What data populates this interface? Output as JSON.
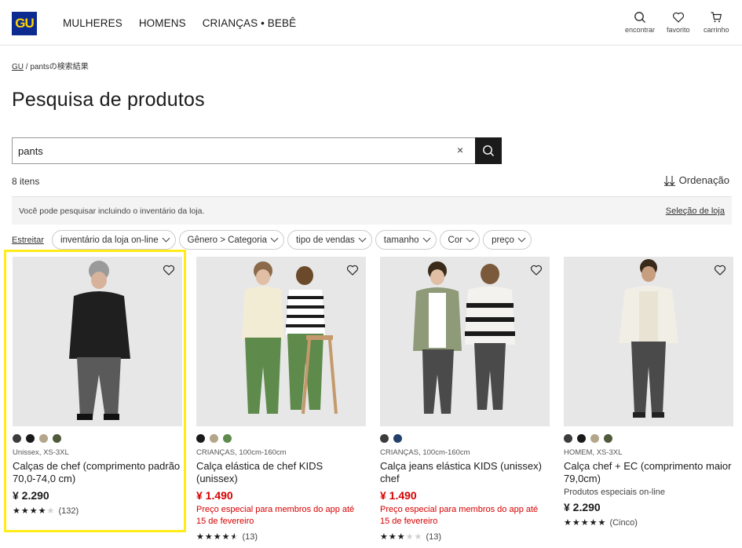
{
  "header": {
    "logo": "GU",
    "nav": [
      "MULHERES",
      "HOMENS",
      "CRIANÇAS • BEBÊ"
    ],
    "utils": {
      "search": "encontrar",
      "favorite": "favorito",
      "cart": "carrinho"
    }
  },
  "breadcrumb": {
    "home": "GU",
    "separator": "/",
    "current": "pantsの検索結果"
  },
  "page_title": "Pesquisa de produtos",
  "search": {
    "value": "pants",
    "clear": "×"
  },
  "results": {
    "count": "8 itens",
    "sort": "Ordenação"
  },
  "notice": {
    "text": "Você pode pesquisar incluindo o inventário da loja.",
    "link": "Seleção de loja"
  },
  "filters": {
    "refine": "Estreitar",
    "chips": [
      "inventário da loja on-line",
      "Gênero > Categoria",
      "tipo de vendas",
      "tamanho",
      "Cor",
      "preço"
    ]
  },
  "colors": {
    "accent_red": "#d70000",
    "highlight": "#ffec1a",
    "logo_bg": "#0c2a8f",
    "logo_fg": "#ffd400"
  },
  "products": [
    {
      "swatches": [
        "#3c3c3c",
        "#1a1a1a",
        "#b3a68a",
        "#4f5a3a"
      ],
      "meta": "Unissex, XS-3XL",
      "name": "Calças de chef (comprimento padrão 70,0-74,0 cm)",
      "price": "¥ 2.290",
      "price_style": "normal",
      "promo": "",
      "special": "",
      "stars": "★★★★★",
      "rating_value": 4,
      "reviews": "(132)"
    },
    {
      "swatches": [
        "#1a1a1a",
        "#b3a68a",
        "#5e8a4c"
      ],
      "meta": "CRIANÇAS, 100cm-160cm",
      "name": "Calça elástica de chef KIDS (unissex)",
      "price": "¥ 1.490",
      "price_style": "red",
      "promo": "Preço especial para membros do app até 15 de fevereiro",
      "special": "",
      "stars": "★★★★★",
      "rating_value": 4.5,
      "reviews": "(13)"
    },
    {
      "swatches": [
        "#3c3c3c",
        "#23406b"
      ],
      "meta": "CRIANÇAS, 100cm-160cm",
      "name": "Calça jeans elástica KIDS (unissex) chef",
      "price": "¥ 1.490",
      "price_style": "red",
      "promo": "Preço especial para membros do app até 15 de fevereiro",
      "special": "",
      "stars": "★★★★★",
      "rating_value": 3,
      "reviews": "(13)"
    },
    {
      "swatches": [
        "#3c3c3c",
        "#1a1a1a",
        "#b3a68a",
        "#4f5a3a"
      ],
      "meta": "HOMEM, XS-3XL",
      "name": "Calça chef + EC (comprimento maior 79,0cm)",
      "price": "¥ 2.290",
      "price_style": "normal",
      "promo": "",
      "special": "Produtos especiais on-line",
      "stars": "★★★★★",
      "rating_value": 5,
      "reviews": "(Cinco)"
    }
  ]
}
